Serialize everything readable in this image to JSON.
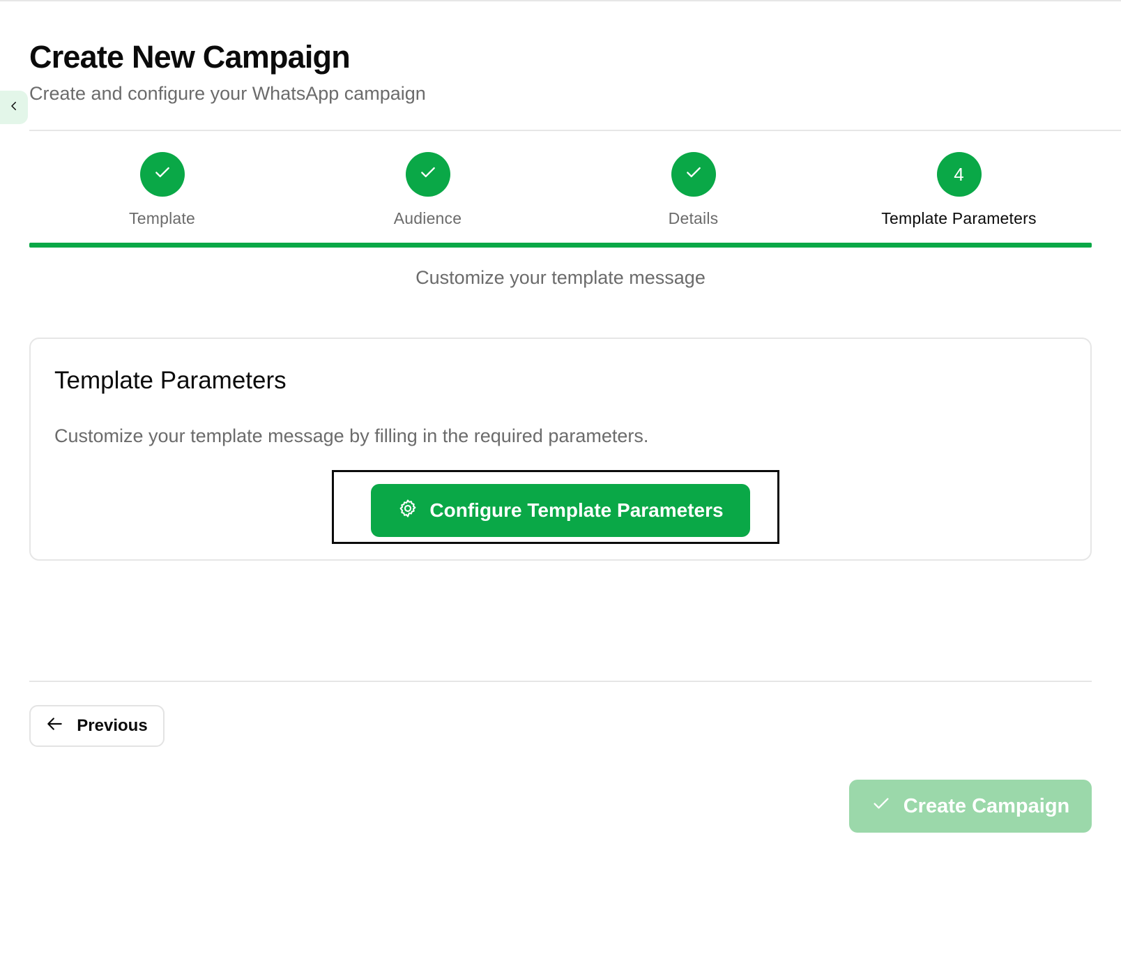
{
  "header": {
    "title": "Create New Campaign",
    "subtitle": "Create and configure your WhatsApp campaign"
  },
  "sidebar_toggle": {
    "icon": "chevron-left-icon"
  },
  "stepper": {
    "steps": [
      {
        "label": "Template",
        "state": "completed",
        "icon": "check-icon"
      },
      {
        "label": "Audience",
        "state": "completed",
        "icon": "check-icon"
      },
      {
        "label": "Details",
        "state": "completed",
        "icon": "check-icon"
      },
      {
        "label": "Template Parameters",
        "state": "active",
        "number": "4"
      }
    ],
    "progress": 1.0,
    "caption": "Customize your template message"
  },
  "card": {
    "title": "Template Parameters",
    "description": "Customize your template message by filling in the required parameters.",
    "configure_button": {
      "label": "Configure Template Parameters",
      "icon": "gear-icon"
    }
  },
  "footer": {
    "previous_button": {
      "label": "Previous",
      "icon": "arrow-left-icon"
    },
    "create_button": {
      "label": "Create Campaign",
      "icon": "check-icon",
      "disabled": true
    }
  },
  "colors": {
    "accent": "#0aa847",
    "accent_disabled": "#9bd8aa",
    "text_primary": "#0b0b0b",
    "text_muted": "#6b6b6b",
    "border": "#e6e6e6",
    "toggle_bg": "#e3f6e9"
  }
}
